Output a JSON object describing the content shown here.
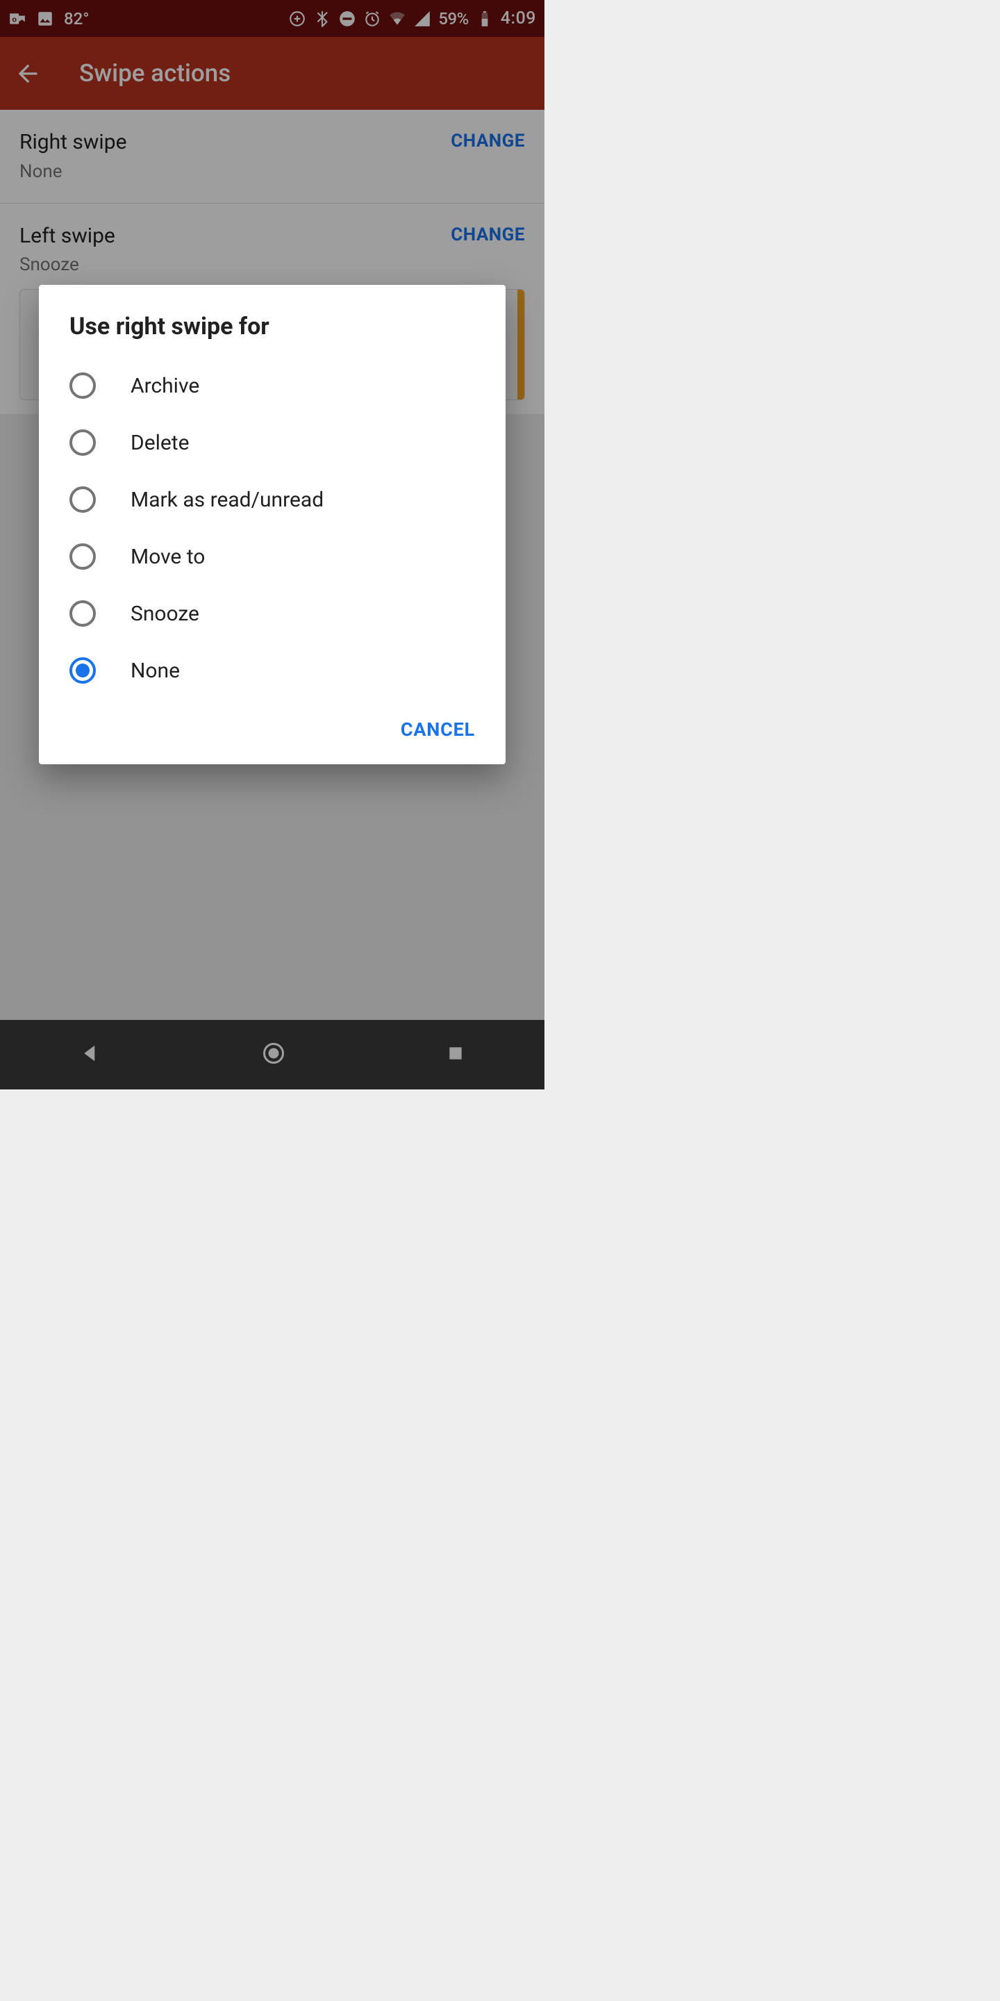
{
  "status_bar": {
    "temperature": "82°",
    "battery_pct": "59%",
    "clock": "4:09",
    "icons": {
      "outlook": "outlook-icon",
      "image": "image-icon",
      "circle_plus": "circle-plus-icon",
      "bluetooth": "bluetooth-icon",
      "dnd": "dnd-icon",
      "alarm": "alarm-icon",
      "wifi": "wifi-icon",
      "cell": "cell-icon",
      "battery": "battery-icon"
    }
  },
  "app_bar": {
    "title": "Swipe actions"
  },
  "settings": {
    "right_swipe": {
      "label": "Right swipe",
      "value": "None",
      "action": "CHANGE"
    },
    "left_swipe": {
      "label": "Left swipe",
      "value": "Snooze",
      "action": "CHANGE"
    }
  },
  "dialog": {
    "title": "Use right swipe for",
    "options": [
      {
        "label": "Archive",
        "selected": false
      },
      {
        "label": "Delete",
        "selected": false
      },
      {
        "label": "Mark as read/unread",
        "selected": false
      },
      {
        "label": "Move to",
        "selected": false
      },
      {
        "label": "Snooze",
        "selected": false
      },
      {
        "label": "None",
        "selected": true
      }
    ],
    "cancel_label": "CANCEL"
  },
  "colors": {
    "status_bg": "#6d0e0e",
    "appbar_bg": "#b93220",
    "accent": "#1a73e8",
    "text_primary": "#212121",
    "text_secondary": "#757575"
  }
}
